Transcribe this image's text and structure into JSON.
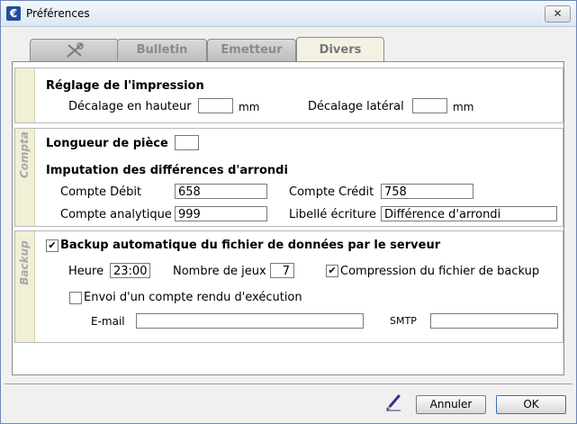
{
  "window": {
    "title": "Préférences",
    "close_label": "✕",
    "app_icon_glyph": "€"
  },
  "tabs": [
    {
      "label": "",
      "icon": "tools-icon"
    },
    {
      "label": "Bulletin"
    },
    {
      "label": "Emetteur"
    },
    {
      "label": "Divers"
    }
  ],
  "print": {
    "heading": "Réglage de l'impression",
    "offset_height_label": "Décalage en hauteur",
    "offset_height_value": "",
    "offset_height_unit": "mm",
    "offset_side_label": "Décalage latéral",
    "offset_side_value": "",
    "offset_side_unit": "mm"
  },
  "compta": {
    "section_label": "Compta",
    "piece_length_label": "Longueur de pièce",
    "piece_length_value": "",
    "rounding_heading": "Imputation des différences d'arrondi",
    "debit_label": "Compte Débit",
    "debit_value": "658",
    "credit_label": "Compte Crédit",
    "credit_value": "758",
    "analytic_label": "Compte analytique",
    "analytic_value": "999",
    "entry_label": "Libellé écriture",
    "entry_value": "Différence d'arrondi"
  },
  "backup": {
    "section_label": "Backup",
    "auto_label": "Backup automatique du fichier de données par le serveur",
    "auto_checked": "✔",
    "hour_label": "Heure",
    "hour_value": "23:00",
    "sets_label": "Nombre de jeux",
    "sets_value": "7",
    "compress_label": "Compression du fichier de backup",
    "compress_checked": "✔",
    "report_label": "Envoi d'un compte rendu d'exécution",
    "report_checked": "",
    "email_label": "E-mail",
    "email_value": "",
    "smtp_label": "SMTP",
    "smtp_value": ""
  },
  "footer": {
    "cancel_label": "Annuler",
    "ok_label": "OK",
    "pen_icon": "pen-icon"
  }
}
